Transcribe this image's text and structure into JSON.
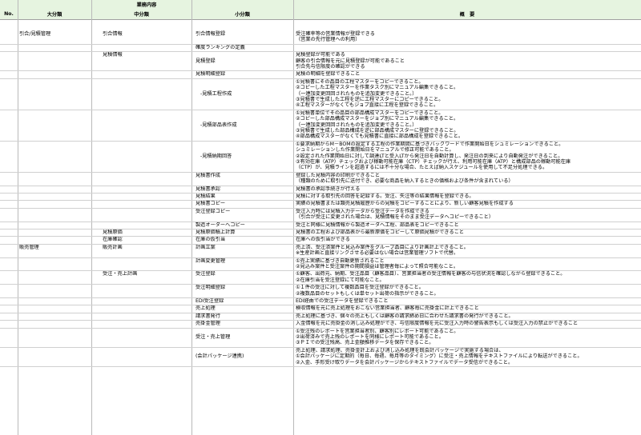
{
  "header": {
    "group": "業務内容",
    "no": "No.",
    "major": "大分類",
    "middle": "中分類",
    "minor": "小分類",
    "overview": "概　要"
  },
  "rows": [
    {
      "major": "引合/見積管理",
      "middle": "引合情報",
      "minor": "引合情報登録",
      "desc": [
        "受注確率等の営業情報が登録できる",
        "（営業の先行管理への利用）"
      ]
    },
    {
      "minor": "確度ランキングの定義",
      "desc": []
    },
    {
      "middle": "見積情報",
      "minor": "見積登録",
      "desc": [
        "見積登録が可能である",
        "顧客の引合情報を元に見積登録が可能であること",
        "引合先与信限度の確認ができる"
      ]
    },
    {
      "minor": "見積明細登録",
      "desc": [
        "見積の明細を登録できること"
      ]
    },
    {
      "minor": "-見積工程作成",
      "indent": true,
      "desc": [
        "①見積書にその品目の工程マスターをコピーできること。",
        "②コピーした工程マスターを作業タスク別にマニュアル編集できること。",
        "（一連加変更回回されたものを追加変更できること。）",
        "③見積書で生成した工程を逆に工程マスターにコピーできること。",
        "④工程マスターがなくてもジョブ直接に工程を登録できること。"
      ]
    },
    {
      "minor": "-見積部品表作成",
      "indent": true,
      "desc": [
        "①見積書単位でその品目の部品構成マスターをコピーできること。",
        "②コピーした部品構成マスターをジョブ別にマニュアル編集できること。",
        "（一連加変更回回されたものを追加変更できること。）",
        "③見積書で生成した部品構成を逆に部品構成マスターに登録できること。",
        "④部品構成マスターがなくても見積書に直接に部品構成を登録できること。"
      ]
    },
    {
      "minor": "-見積納期回答",
      "indent": true,
      "desc": [
        "①要求納期からM－BOMの設定する工程の作業期間に基づきバックワードで作業開始日をシュミレーションできること。",
        "シュミレーションした作業開始日をマニュアルで修正可能であること。",
        "②設定された作業開始日に対して調達LTと受入LTから発注日を自動計算し、発注日の到来により自動発注ができること。",
        "③有効在庫（ATP）チェックおよび稼動可能在庫（CTP）チェックが行え、利用可能在庫（ATP）と構成部品の稼動可能在庫",
        "（CTP）が、見積ラインを超過するには不十分な場合、たとえば納入スケジュールを使用して不足分処理できる。"
      ]
    },
    {
      "minor": "見積書作成",
      "desc": [
        "登録した見積内容の印刷ができること",
        "（種類のために取引先に送付でき、必要な商品を納入するときの価格および条件が含まれている）"
      ]
    },
    {
      "minor": "見積書承認",
      "desc": [
        "見積書の承認手続きが行える"
      ]
    },
    {
      "minor": "見積結果",
      "desc": [
        "見積に対する取引先の回答を記録する。受注、失注等の結果情報を登録できる。"
      ]
    },
    {
      "minor": "見積書コピー",
      "desc": [
        "実績の見積書または類売見積履歴からの見積をコピーすることにより、新しい顧客見積を作成する"
      ]
    },
    {
      "minor": "受注登録コピー",
      "desc": [
        "受注入力時には見積入力データから受注データを作成できる",
        "（引合が受注に変更された場合は、見積情報をそのまま受注データへコピーできること）"
      ]
    },
    {
      "minor": "製造オーダーへコピー",
      "desc": [
        "受注と同様に見積情報から製造オーダへ工程、部品表をコピーできること"
      ]
    },
    {
      "middle": "見積原価",
      "minor": "見積原価積上計算",
      "desc": [
        "見積書の工程および部品表から最新原価をコピーして原価見積ができること"
      ]
    },
    {
      "middle": "在庫確認",
      "minor": "在庫の仮引当",
      "desc": [
        "在庫への仮引当ができる"
      ]
    },
    {
      "major": "販売管理",
      "middle": "販売計画",
      "minor": "計画立案",
      "desc": [
        "売上済、受注済案件と見込み案件をグループ品目により計画計上できること。",
        "※生産計画と直接リンクさせる必要はない場合は営業管理ソフトで代替。"
      ]
    },
    {
      "minor": "計画変更管理",
      "desc": [
        "①売上実績に基づき自動更新されること",
        "②見込み案件と受注案件の期間損益は管理者毎によって照合可能なこと。"
      ]
    },
    {
      "middle": "受注・売上計画",
      "minor": "受注登録",
      "desc": [
        "①顧客、出荷元、納期、受注品目（顧客品目）、営業担当者の受注情報を顧客の与信状況を確認しながら登録できること。",
        "②在庫引当を受注登録にて可能なこと。"
      ]
    },
    {
      "minor": "受注明細登録",
      "desc": [
        "①１件の受注に対して複数品目を受注登録ができること。",
        "②複数品目のセットもしくは単セット出荷の指示ができること。"
      ]
    },
    {
      "minor": "EDI受注登録",
      "desc": [
        "EDI経由での受注データを登録できること"
      ]
    },
    {
      "minor": "売上処理",
      "desc": [
        "検収情報を元に売上処理をおこない営業担当者、顧客毎に売掛金に計上できること"
      ]
    },
    {
      "minor": "請求書発行",
      "desc": [
        "売上処理に基づき、個々の売上もしくは顧客の請求締め日に合わせた請求書の発行ができること。"
      ]
    },
    {
      "minor": "売掛金管理",
      "desc": [
        "入金情報を元に売掛金の消し込み処理ができ、与信限度情報を元に受注入力時の警告表示もしくは受注入力の禁止ができること"
      ]
    },
    {
      "minor": "受注・売上管理",
      "desc": [
        "①受注残のレポートを営業担当者別、顧客別にレポート可能であること。",
        "②出荷済みで売上残のレポートを同様にレポート可能であること。",
        "③ＰＩでの受注残高、売上金額推移データを保存できること。"
      ]
    },
    {
      "minor": "(会計パッケージ連携)",
      "desc": [
        "売上処理、請求処理、売掛金計上および消し込み処理を既会計パッケージで実施する場合は、",
        "①会計パッケージに定期的（毎日、毎週、毎月等のタイミング）に受注・売上情報をテキストファイルにより転送ができること。",
        "②入金、手形受け取りデータを会計パッケージからテキストファイルでデータ受信ができること。"
      ]
    }
  ]
}
